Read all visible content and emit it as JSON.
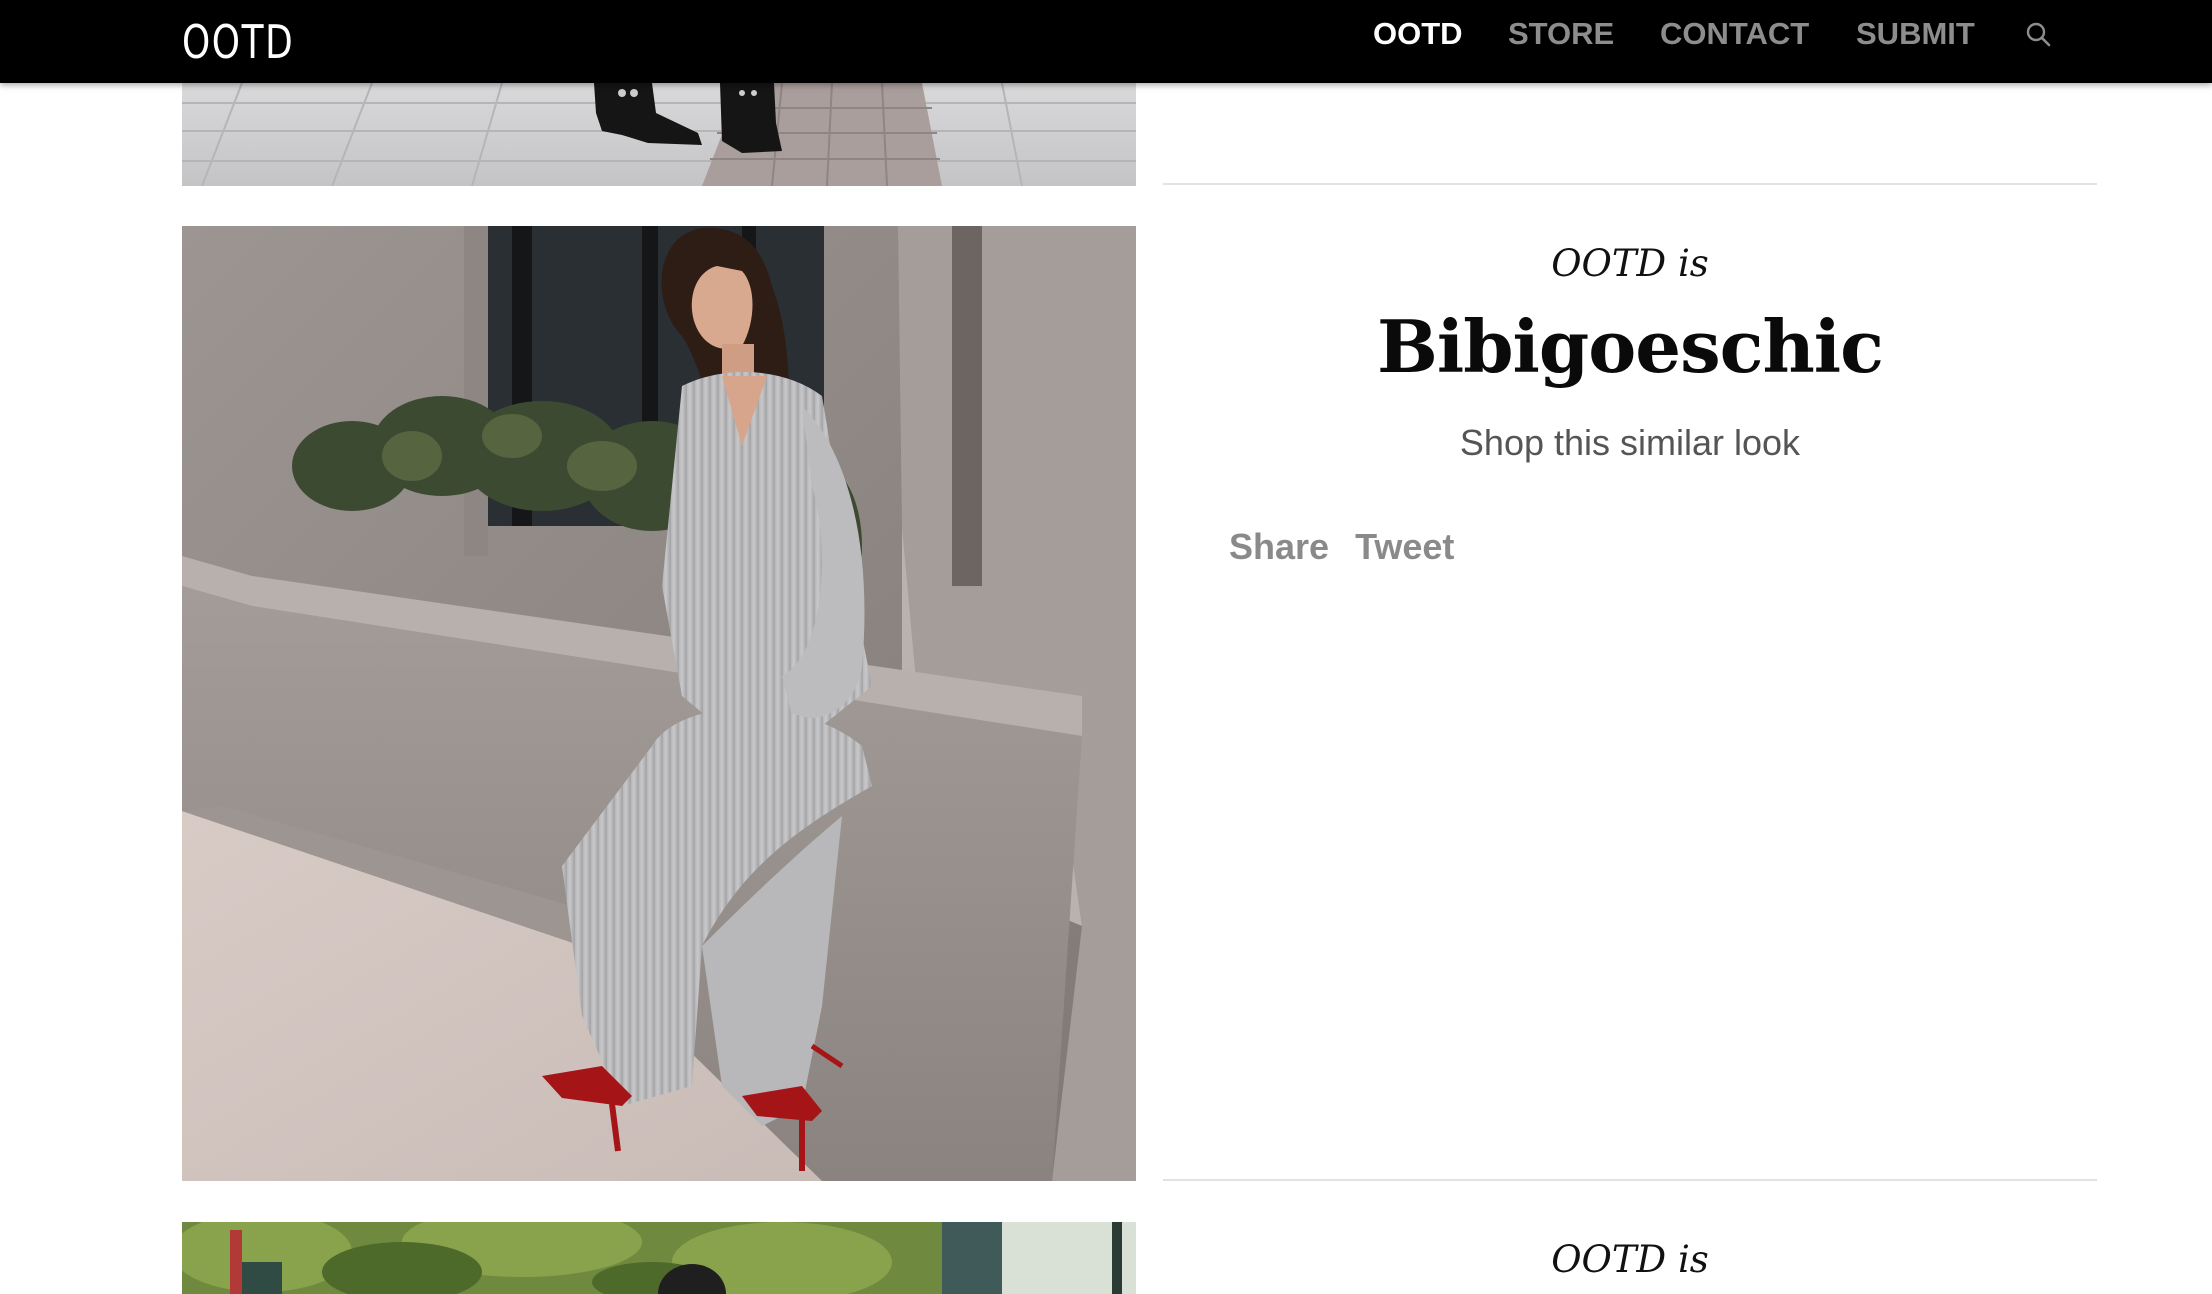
{
  "header": {
    "logo": "OOTD",
    "nav": [
      {
        "label": "OOTD",
        "active": true
      },
      {
        "label": "STORE",
        "active": false
      },
      {
        "label": "CONTACT",
        "active": false
      },
      {
        "label": "SUBMIT",
        "active": false
      }
    ],
    "search_icon": "search-icon"
  },
  "posts": [
    {
      "kicker": "OOTD is",
      "name": "Bibigoeschic",
      "shop_link": "Shop this similar look",
      "share": "Share",
      "tweet": "Tweet"
    },
    {
      "kicker": "OOTD is"
    }
  ]
}
